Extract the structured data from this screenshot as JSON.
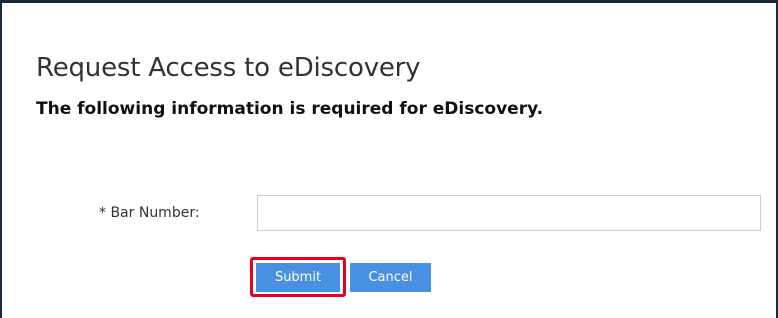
{
  "page": {
    "title": "Request Access to eDiscovery",
    "subtitle": "The following information is required for eDiscovery."
  },
  "form": {
    "bar_number_label": "* Bar Number:",
    "bar_number_value": "",
    "bar_number_placeholder": ""
  },
  "actions": {
    "submit_label": "Submit",
    "cancel_label": "Cancel"
  },
  "colors": {
    "button_bg": "#4a90e2",
    "highlight": "#e8001c",
    "frame_border": "#1b2a3a"
  }
}
